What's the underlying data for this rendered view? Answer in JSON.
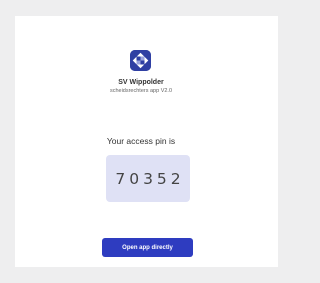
{
  "app": {
    "name": "SV Wippolder",
    "subtitle": "scheidsrechters app V2.0",
    "logo_icon": "app-logo-icon",
    "brand_color": "#2f3fa3"
  },
  "pin": {
    "label": "Your access pin is",
    "value": "70352",
    "box_color": "#dfe1f5"
  },
  "actions": {
    "open_app_label": "Open app directly",
    "button_color": "#2e3cc0"
  }
}
